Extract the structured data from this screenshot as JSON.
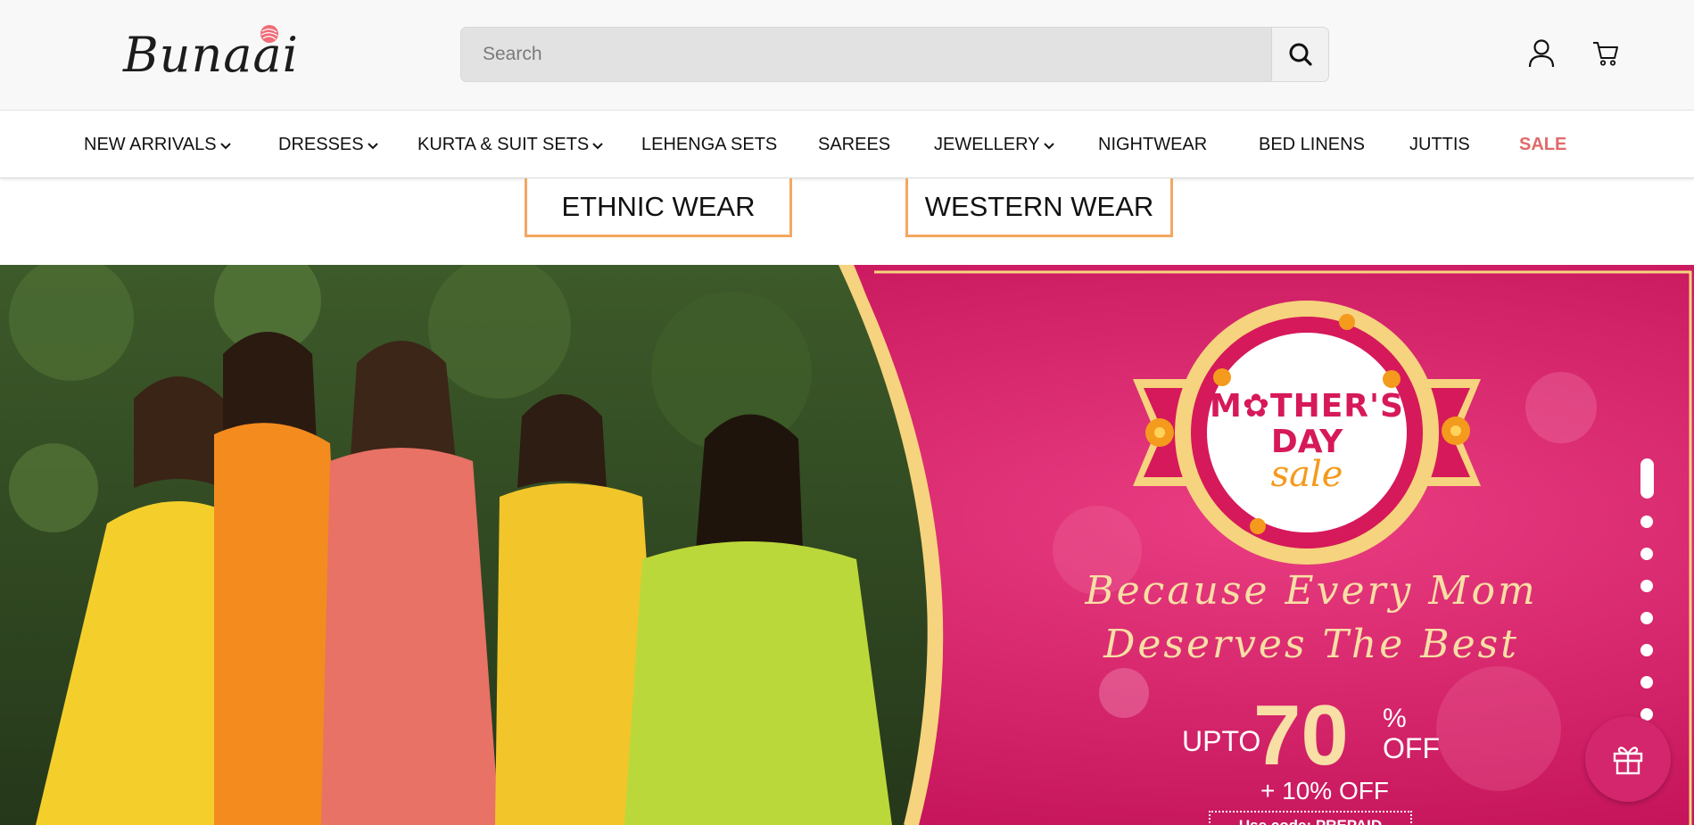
{
  "header": {
    "logo_text": "Bunaai",
    "search": {
      "placeholder": "Search",
      "value": ""
    },
    "icons": [
      "search-icon",
      "account-icon",
      "cart-icon"
    ]
  },
  "nav": {
    "items": [
      {
        "label": "NEW ARRIVALS",
        "has_dropdown": true
      },
      {
        "label": "DRESSES",
        "has_dropdown": true
      },
      {
        "label": "KURTA & SUIT SETS",
        "has_dropdown": true
      },
      {
        "label": "LEHENGA SETS",
        "has_dropdown": false
      },
      {
        "label": "SAREES",
        "has_dropdown": false
      },
      {
        "label": "JEWELLERY",
        "has_dropdown": true
      },
      {
        "label": "NIGHTWEAR",
        "has_dropdown": false
      },
      {
        "label": "BED LINENS",
        "has_dropdown": false
      },
      {
        "label": "JUTTIS",
        "has_dropdown": false
      },
      {
        "label": "SALE",
        "has_dropdown": false,
        "color": "#e06a6a"
      }
    ]
  },
  "category_tabs": [
    "ETHNIC WEAR",
    "WESTERN WEAR"
  ],
  "hero": {
    "badge_line1": "M✿THER'S",
    "badge_line2": "DAY",
    "badge_line3": "sale",
    "tagline_line1": "Because Every Mom",
    "tagline_line2": "Deserves The Best",
    "offer_prefix": "UPTO",
    "offer_value": "70",
    "offer_percent": "%",
    "offer_suffix": "OFF",
    "extra_offer": "+ 10% OFF",
    "prepaid_text": "Use code: PREPAID",
    "slide_count": 10,
    "active_slide": 1
  },
  "colors": {
    "accent_tab_border": "#f4a761",
    "promo_background": "#d11a61",
    "sale_text": "#e06a6a",
    "gift_button": "#d4266c",
    "gold_text": "#f7dfa5"
  },
  "floating": {
    "icon": "gift-icon"
  }
}
